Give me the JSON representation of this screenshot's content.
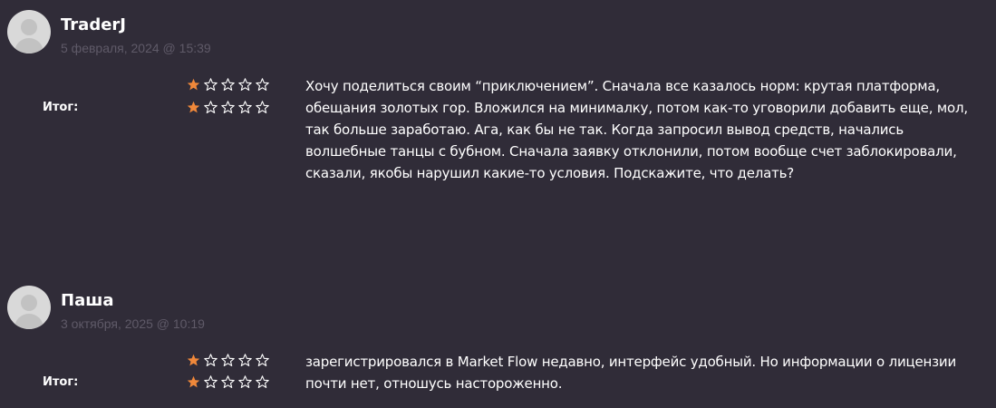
{
  "reviews": [
    {
      "author": "TraderJ",
      "date": "5 февраля, 2024 @ 15:39",
      "total_label": "Итог:",
      "ratings": [
        1,
        1
      ],
      "max_rating": 5,
      "text": "Хочу поделиться своим “приключением”. Сначала все казалось норм: крутая платформа, обещания золотых гор. Вложился на минималку, потом как-то уговорили добавить еще, мол, так больше заработаю. Ага, как бы не так. Когда запросил вывод средств, начались волшебные танцы с бубном. Сначала заявку отклонили, потом вообще счет заблокировали, сказали, якобы нарушил какие-то условия. Подскажите, что делать?"
    },
    {
      "author": "Паша",
      "date": "3 октября, 2025 @ 10:19",
      "total_label": "Итог:",
      "ratings": [
        1,
        1
      ],
      "max_rating": 5,
      "text": "зарегистрировался в Market Flow недавно, интерфейс удобный. Но информации о лицензии почти нет, отношусь настороженно."
    }
  ],
  "colors": {
    "background": "#302c38",
    "star_filled": "#f0883a",
    "star_empty": "#ffffff",
    "date": "#5f5a68"
  },
  "icons": {
    "avatar": "user-placeholder-icon",
    "star_filled": "star-filled-icon",
    "star_empty": "star-outline-icon"
  }
}
